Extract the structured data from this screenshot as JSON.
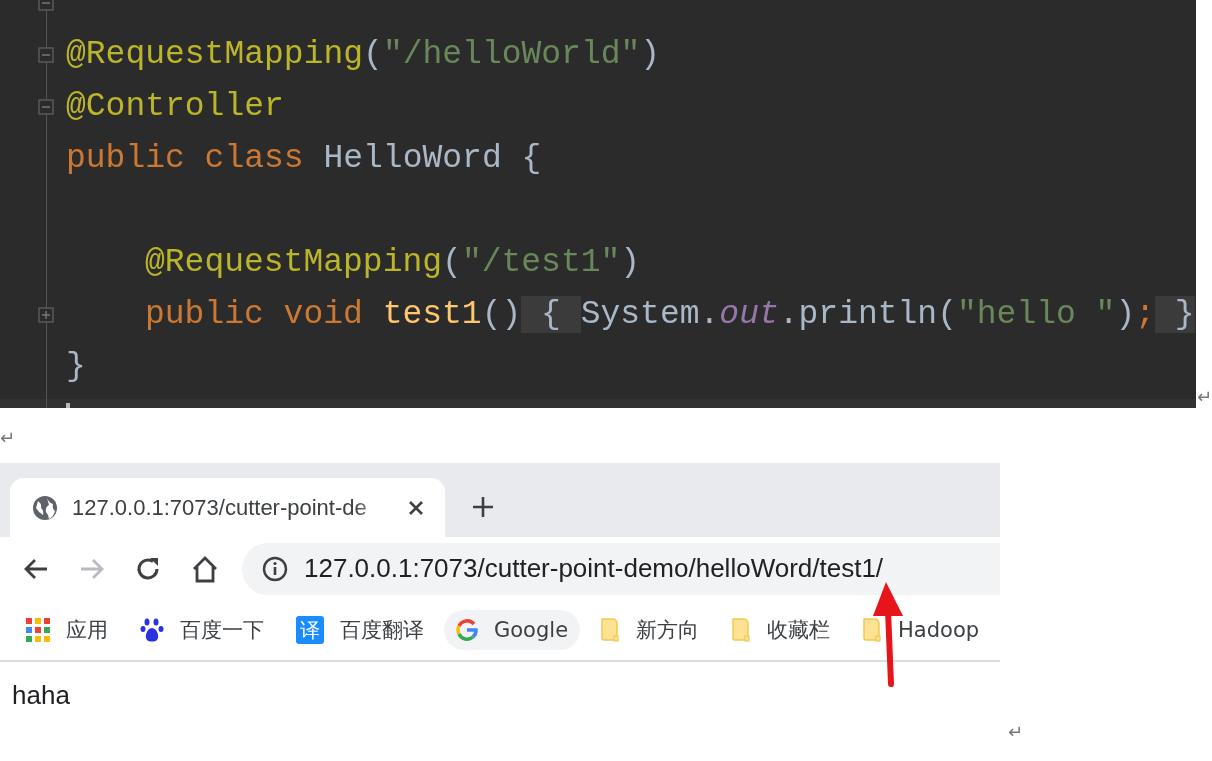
{
  "editor": {
    "lines": [
      {
        "kind": "collapsible"
      },
      {
        "kind": "collapsible",
        "indented": false,
        "tokens": [
          {
            "kind": "annotation",
            "text": "@RequestMapping"
          },
          {
            "kind": "plain",
            "text": "("
          },
          {
            "kind": "string",
            "text": "\"/helloWorld\""
          },
          {
            "kind": "plain",
            "text": ")"
          }
        ]
      },
      {
        "kind": "collapsible",
        "indented": false,
        "tokens": [
          {
            "kind": "annotation",
            "text": "@Controller"
          }
        ]
      },
      {
        "kind": "plain",
        "indented": false,
        "tokens": [
          {
            "kind": "keyword",
            "text": "public class "
          },
          {
            "kind": "plain",
            "text": "HelloWord {"
          }
        ]
      },
      {
        "kind": "plain"
      },
      {
        "kind": "plain",
        "indented": true,
        "tokens": [
          {
            "kind": "annotation",
            "text": "@RequestMapping"
          },
          {
            "kind": "plain",
            "text": "("
          },
          {
            "kind": "string",
            "text": "\"/test1\""
          },
          {
            "kind": "plain",
            "text": ")"
          }
        ]
      },
      {
        "kind": "expandable",
        "indented": true,
        "tokens": [
          {
            "kind": "keyword",
            "text": "public void "
          },
          {
            "kind": "method",
            "text": "test1"
          },
          {
            "kind": "plain",
            "text": "()"
          },
          {
            "kind": "folded",
            "text": " { "
          },
          {
            "kind": "plain",
            "text": "System."
          },
          {
            "kind": "static",
            "text": "out"
          },
          {
            "kind": "plain",
            "text": ".println("
          },
          {
            "kind": "string",
            "text": "\"hello \""
          },
          {
            "kind": "plain",
            "text": ")"
          },
          {
            "kind": "keyword",
            "text": ";"
          },
          {
            "kind": "folded",
            "text": " }"
          }
        ]
      },
      {
        "kind": "plain",
        "indented": false,
        "tokens": [
          {
            "kind": "plain",
            "text": "}"
          }
        ]
      }
    ]
  },
  "marks": [
    "↵",
    "↵",
    "↵"
  ],
  "browser": {
    "tabs": [
      {
        "title": "127.0.0.1:7073/cutter-point-de",
        "selected": true
      }
    ],
    "nav": [
      {
        "kind": "back",
        "disabled": false
      },
      {
        "kind": "forward",
        "disabled": true
      },
      {
        "kind": "reload",
        "disabled": false
      },
      {
        "kind": "home",
        "disabled": false
      }
    ],
    "address": "127.0.0.1:7073/cutter-point-demo/helloWord/test1/",
    "bookmarks": [
      {
        "kind": "apps",
        "label": "应用",
        "highlighted": false
      },
      {
        "kind": "paw",
        "label": "百度一下",
        "highlighted": false
      },
      {
        "kind": "translate",
        "icon_text": "译",
        "label": "百度翻译",
        "highlighted": false
      },
      {
        "kind": "google",
        "label": "Google",
        "highlighted": true
      },
      {
        "kind": "folder",
        "label": "新方向",
        "highlighted": false
      },
      {
        "kind": "folder",
        "label": "收藏栏",
        "highlighted": false
      },
      {
        "kind": "folder",
        "label": "Hadoop",
        "highlighted": false
      }
    ],
    "content": "haha"
  }
}
